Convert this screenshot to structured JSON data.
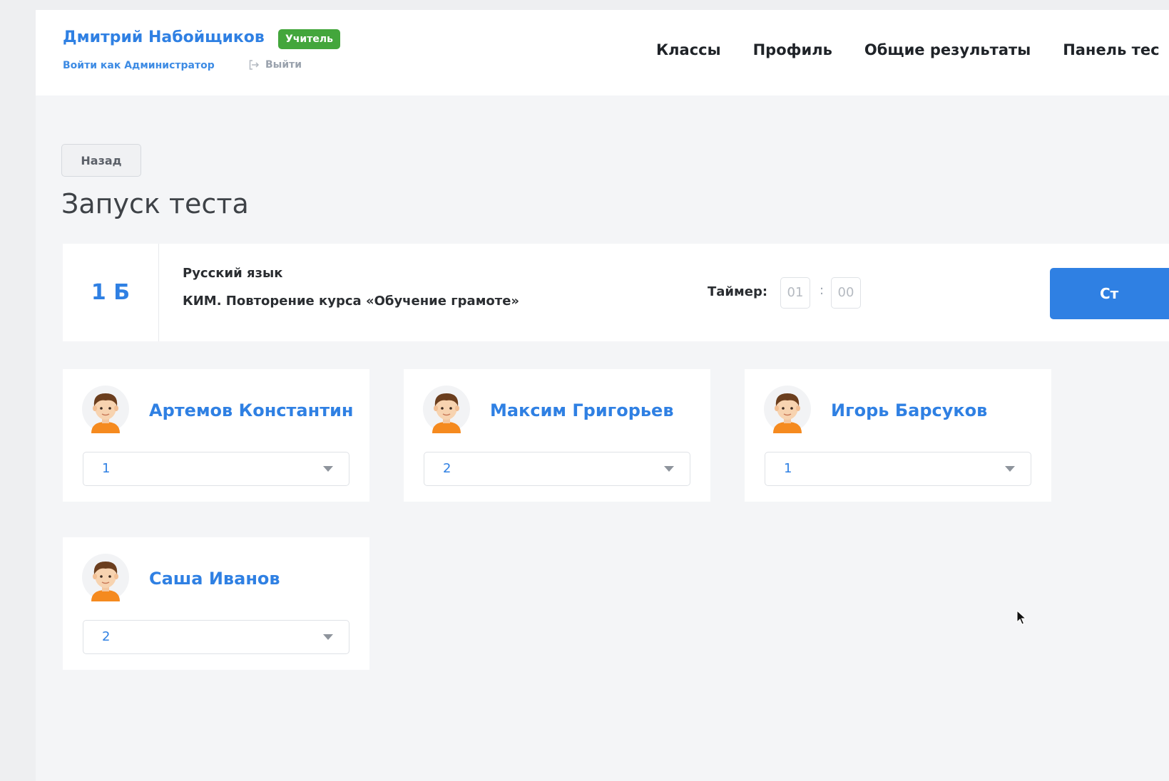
{
  "header": {
    "user_name": "Дмитрий Набойщиков",
    "role_badge": "Учитель",
    "admin_link": "Войти как Администратор",
    "logout_label": "Выйти",
    "nav": [
      {
        "label": "Классы"
      },
      {
        "label": "Профиль"
      },
      {
        "label": "Общие результаты"
      },
      {
        "label": "Панель тес"
      }
    ]
  },
  "back_button": "Назад",
  "page_title": "Запуск теста",
  "test": {
    "class_name": "1 Б",
    "subject": "Русский язык",
    "name": "КИМ. Повторение курса «Обучение грамоте»",
    "timer_label": "Таймер:",
    "timer_minutes": "01",
    "timer_separator": ":",
    "timer_seconds": "00",
    "start_button": "Ст"
  },
  "students": [
    {
      "name": "Артемов Константин",
      "variant": "1"
    },
    {
      "name": "Максим Григорьев",
      "variant": "2"
    },
    {
      "name": "Игорь Барсуков",
      "variant": "1"
    },
    {
      "name": "Саша Иванов",
      "variant": "2"
    }
  ],
  "colors": {
    "accent": "#2f80e3",
    "badge_green": "#43a63c",
    "page_bg": "#f4f5f7"
  }
}
